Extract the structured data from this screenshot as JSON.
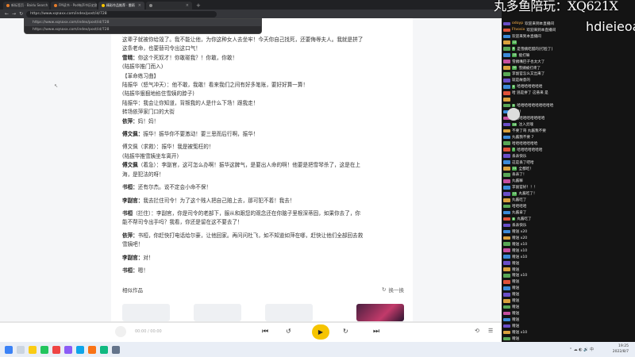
{
  "browser": {
    "tabs": [
      {
        "label": "新标签页 · Baidu Search",
        "active": false
      },
      {
        "label": "FM读书 - Pod有声书历史剧场",
        "active": false
      },
      {
        "label": "精彩作品推荐 · 雷雨",
        "active": true
      },
      {
        "label": "",
        "active": false
      }
    ],
    "url": "https://www.xqnaxx.com/index/post/id/728",
    "suggestions": [
      "https://www.xqnaxx.com/index/post/id/728",
      "https://www.xqnaxx.com/index/post/id/728"
    ]
  },
  "article": {
    "lines": [
      {
        "text": "这辈子就被你给毁了。我不能让他，为你这种女人去坐牢！今天你自己找死，还要侮辱夫人。我就是拼了",
        "speaker": ""
      },
      {
        "text": "这条老命，也要替司令出这口气！",
        "speaker": ""
      },
      {
        "text": "你这个死奴才！你敢碰我？！你敢，你敢！",
        "speaker": "雪晴："
      },
      {
        "text": "(陆振华推门而入)",
        "speaker": ""
      },
      {
        "text": "【革命练习曲】",
        "speaker": ""
      },
      {
        "text": "陆振华（怒气冲天）：他不敢，我敢！看来我们之间有好多笔账，要好好算一算！",
        "speaker": ""
      },
      {
        "text": "(陆振华狠狠地掐住雪姨的脖子)",
        "speaker": ""
      },
      {
        "text": "陆振华：我会让你知道，背叛我的人是什么下场！跟我走！",
        "speaker": ""
      },
      {
        "text": "转场依萍家门口的大街",
        "speaker": ""
      },
      {
        "text": "妈！妈！",
        "speaker": "依萍："
      },
      {
        "text": "",
        "speaker": "gap"
      },
      {
        "text": "振华！振华你不要激动！要三思而后行啊，振华！",
        "speaker": "傅文佩："
      },
      {
        "text": "",
        "speaker": "gap"
      },
      {
        "text": "傅文佩（求救）：振华！我是被冤枉的！",
        "speaker": ""
      },
      {
        "text": "(陆振华推雪姨坐车离开)",
        "speaker": ""
      },
      {
        "text": "（着急）：李副官，这可怎么办啊！振华这脾气，是要出人命的啊！他要是把雪琴杀了，这是在上",
        "speaker": "傅文佩"
      },
      {
        "text": "海，是犯法的呀！",
        "speaker": ""
      },
      {
        "text": "",
        "speaker": "gap"
      },
      {
        "text": "还有尔杰。说不定会小命不保！",
        "speaker": "书桓："
      },
      {
        "text": "",
        "speaker": "gap"
      },
      {
        "text": "我去拦住司令！为了这个贱人把自己赔上去，那可犯不着！我去！",
        "speaker": "李副官："
      },
      {
        "text": "",
        "speaker": "gap"
      },
      {
        "text": "（拦住）：李副官，你是司令的老部下，服从和跟您的观念还在你脑子里根深蒂固，如果你去了，你",
        "speaker": "书桓"
      },
      {
        "text": "能不帮司令出手吗？我看，你还是留在这不要去了！",
        "speaker": ""
      },
      {
        "text": "",
        "speaker": "gap"
      },
      {
        "text": "书桓，你赶快打电话给尔豪，让他回家。再问问杜飞，如不知道如萍在哪，赶快让他们全部回去救",
        "speaker": "依萍："
      },
      {
        "text": "雪姨吧！",
        "speaker": ""
      },
      {
        "text": "",
        "speaker": "gap"
      },
      {
        "text": "对！",
        "speaker": "李副官："
      },
      {
        "text": "",
        "speaker": "gap"
      },
      {
        "text": "嗯！",
        "speaker": "书桓："
      }
    ],
    "similar_title": "相似作品",
    "refresh_label": "换一换"
  },
  "player": {
    "time": "00:00 / 00:00",
    "progress": 0.0,
    "accent": "#f6c400"
  },
  "stream": {
    "watermark": "丸多鱼陪玩：XQ621X",
    "watermark2": "hdieieoa",
    "chat": [
      {
        "badge": "#6b4fc8",
        "lvl": "",
        "nick": "odoyp",
        "text": "欢迎来到本直播间"
      },
      {
        "badge": "#e0533a",
        "lvl": "",
        "nick": "Ftvosix",
        "text": "欢迎来到本直播间"
      },
      {
        "badge": "#3d8bd9",
        "lvl": "",
        "nick": "",
        "text": "欢迎来到本直播间"
      },
      {
        "badge": "#d9a13d",
        "lvl": "12",
        "nick": "",
        "text": ""
      },
      {
        "badge": "#5aa857",
        "lvl": "8",
        "nick": "",
        "text": "是雪姨吃醋的[打脸了]"
      },
      {
        "badge": "#3d8bd9",
        "lvl": "15",
        "nick": "",
        "text": "能打嘛"
      },
      {
        "badge": "#c64fa0",
        "lvl": "",
        "nick": "",
        "text": "雪姨嘴巴子也太大了"
      },
      {
        "badge": "#d9a13d",
        "lvl": "10",
        "nick": "",
        "text": "雪姨被打疼了"
      },
      {
        "badge": "#5aa857",
        "lvl": "",
        "nick": "",
        "text": "李副官怎么又出来了"
      },
      {
        "badge": "#6b4fc8",
        "lvl": "",
        "nick": "",
        "text": "就是故意的"
      },
      {
        "badge": "#3d8bd9",
        "lvl": "6",
        "nick": "",
        "text": "哈哈哈哈哈哈哈"
      },
      {
        "badge": "#e0533a",
        "lvl": "",
        "nick": "",
        "text": "哈 逃是拼了 这悬来 是"
      },
      {
        "badge": "#d9a13d",
        "lvl": "",
        "nick": "",
        "text": ""
      },
      {
        "badge": "#5aa857",
        "lvl": "9",
        "nick": "",
        "text": "哈哈哈哈哈哈哈哈哈哈"
      },
      {
        "badge": "#3d8bd9",
        "lvl": "",
        "nick": "",
        "text": "你呢！"
      },
      {
        "badge": "#c64fa0",
        "lvl": "",
        "nick": "",
        "text": "哈哈哈哈哈哈哈哈哈"
      },
      {
        "badge": "#6b4fc8",
        "lvl": "14",
        "nick": "",
        "text": "注入灵魂"
      },
      {
        "badge": "#d9a13d",
        "lvl": "",
        "nick": "",
        "text": "不要了哥 丸酱我不要"
      },
      {
        "badge": "#3d8bd9",
        "lvl": "",
        "nick": "",
        "text": "丸酱我不要 7"
      },
      {
        "badge": "#5aa857",
        "lvl": "",
        "nick": "",
        "text": "哈哈哈哈哈哈哈"
      },
      {
        "badge": "#e0533a",
        "lvl": "7",
        "nick": "",
        "text": "哈哈哈哈哈哈哈"
      },
      {
        "badge": "#6b4fc8",
        "lvl": "",
        "nick": "",
        "text": "丢表快乐"
      },
      {
        "badge": "#3d8bd9",
        "lvl": "",
        "nick": "",
        "text": "这是丢了吧哈"
      },
      {
        "badge": "#d9a13d",
        "lvl": "11",
        "nick": "",
        "text": "全都吃！"
      },
      {
        "badge": "#5aa857",
        "lvl": "",
        "nick": "",
        "text": "丢表了！"
      },
      {
        "badge": "#c64fa0",
        "lvl": "",
        "nick": "",
        "text": "丸酱嘛"
      },
      {
        "badge": "#3d8bd9",
        "lvl": "",
        "nick": "",
        "text": "李副官好！！！"
      },
      {
        "badge": "#6b4fc8",
        "lvl": "13",
        "nick": "",
        "text": "丸酱吃了！"
      },
      {
        "badge": "#d9a13d",
        "lvl": "",
        "nick": "",
        "text": "丸酱吃了"
      },
      {
        "badge": "#5aa857",
        "lvl": "",
        "nick": "",
        "text": "哈哈哈哈"
      },
      {
        "badge": "#3d8bd9",
        "lvl": "",
        "nick": "",
        "text": "丸酱拿了"
      },
      {
        "badge": "#e0533a",
        "lvl": "8",
        "nick": "",
        "text": "丸酱吃了"
      },
      {
        "badge": "#6b4fc8",
        "lvl": "",
        "nick": "",
        "text": "丢表快乐"
      },
      {
        "badge": "#3d8bd9",
        "lvl": "",
        "nick": "",
        "text": "赠送 x20"
      },
      {
        "badge": "#d9a13d",
        "lvl": "",
        "nick": "",
        "text": "赠送 x20"
      },
      {
        "badge": "#5aa857",
        "lvl": "",
        "nick": "",
        "text": "赠送 x10"
      },
      {
        "badge": "#c64fa0",
        "lvl": "",
        "nick": "",
        "text": "赠送 x10"
      },
      {
        "badge": "#3d8bd9",
        "lvl": "",
        "nick": "",
        "text": "赠送 x10"
      },
      {
        "badge": "#6b4fc8",
        "lvl": "",
        "nick": "",
        "text": "赠送"
      },
      {
        "badge": "#d9a13d",
        "lvl": "",
        "nick": "",
        "text": "赠送"
      },
      {
        "badge": "#5aa857",
        "lvl": "",
        "nick": "",
        "text": "赠送 x10"
      },
      {
        "badge": "#e0533a",
        "lvl": "",
        "nick": "",
        "text": "赠送"
      },
      {
        "badge": "#3d8bd9",
        "lvl": "",
        "nick": "",
        "text": "赠送"
      },
      {
        "badge": "#6b4fc8",
        "lvl": "",
        "nick": "",
        "text": "赠送"
      },
      {
        "badge": "#d9a13d",
        "lvl": "",
        "nick": "",
        "text": "赠送"
      },
      {
        "badge": "#5aa857",
        "lvl": "",
        "nick": "",
        "text": "赠送"
      },
      {
        "badge": "#c64fa0",
        "lvl": "",
        "nick": "",
        "text": "赠送"
      },
      {
        "badge": "#3d8bd9",
        "lvl": "",
        "nick": "",
        "text": "赠送"
      },
      {
        "badge": "#6b4fc8",
        "lvl": "",
        "nick": "",
        "text": "赠送"
      },
      {
        "badge": "#d9a13d",
        "lvl": "",
        "nick": "",
        "text": "赠送 x10"
      },
      {
        "badge": "#5aa857",
        "lvl": "",
        "nick": "",
        "text": "赠送"
      },
      {
        "badge": "#e0533a",
        "lvl": "",
        "nick": "",
        "text": "赠送"
      }
    ]
  },
  "taskbar": {
    "time": "19:25",
    "date": "2022/8/7"
  }
}
